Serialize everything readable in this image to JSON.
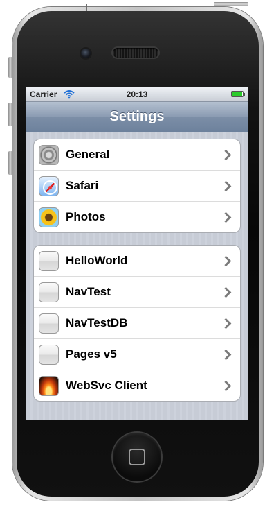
{
  "status_bar": {
    "carrier": "Carrier",
    "time": "20:13",
    "battery_level": 1.0,
    "wifi_icon": "wifi-icon"
  },
  "nav": {
    "title": "Settings"
  },
  "groups": [
    {
      "items": [
        {
          "label": "General",
          "icon": "general-gear-icon"
        },
        {
          "label": "Safari",
          "icon": "safari-compass-icon"
        },
        {
          "label": "Photos",
          "icon": "photos-sunflower-icon"
        }
      ]
    },
    {
      "items": [
        {
          "label": "HelloWorld",
          "icon": "blank-app-icon"
        },
        {
          "label": "NavTest",
          "icon": "blank-app-icon"
        },
        {
          "label": "NavTestDB",
          "icon": "blank-app-icon"
        },
        {
          "label": "Pages v5",
          "icon": "blank-app-icon"
        },
        {
          "label": "WebSvc Client",
          "icon": "fire-app-icon"
        }
      ]
    }
  ],
  "colors": {
    "nav_bar": "#7c8ea7",
    "background_stripes": "#c7ccd6",
    "battery_green": "#2bcc2b"
  }
}
